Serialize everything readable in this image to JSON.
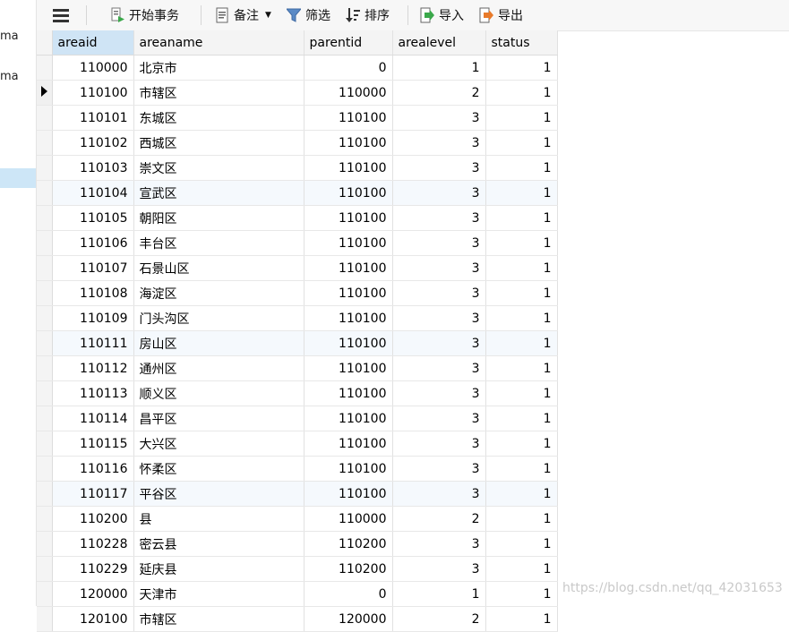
{
  "sidebar": {
    "items": [
      "ma",
      "ma"
    ]
  },
  "toolbar": {
    "menu_icon": "hamburger-menu-icon",
    "begin_transaction": "开始事务",
    "note": "备注",
    "filter": "筛选",
    "sort": "排序",
    "import": "导入",
    "export": "导出"
  },
  "grid": {
    "columns": [
      "areaid",
      "areaname",
      "parentid",
      "arealevel",
      "status"
    ],
    "rows": [
      [
        "110000",
        "北京市",
        "0",
        "1",
        "1"
      ],
      [
        "110100",
        "市辖区",
        "110000",
        "2",
        "1"
      ],
      [
        "110101",
        "东城区",
        "110100",
        "3",
        "1"
      ],
      [
        "110102",
        "西城区",
        "110100",
        "3",
        "1"
      ],
      [
        "110103",
        "崇文区",
        "110100",
        "3",
        "1"
      ],
      [
        "110104",
        "宣武区",
        "110100",
        "3",
        "1"
      ],
      [
        "110105",
        "朝阳区",
        "110100",
        "3",
        "1"
      ],
      [
        "110106",
        "丰台区",
        "110100",
        "3",
        "1"
      ],
      [
        "110107",
        "石景山区",
        "110100",
        "3",
        "1"
      ],
      [
        "110108",
        "海淀区",
        "110100",
        "3",
        "1"
      ],
      [
        "110109",
        "门头沟区",
        "110100",
        "3",
        "1"
      ],
      [
        "110111",
        "房山区",
        "110100",
        "3",
        "1"
      ],
      [
        "110112",
        "通州区",
        "110100",
        "3",
        "1"
      ],
      [
        "110113",
        "顺义区",
        "110100",
        "3",
        "1"
      ],
      [
        "110114",
        "昌平区",
        "110100",
        "3",
        "1"
      ],
      [
        "110115",
        "大兴区",
        "110100",
        "3",
        "1"
      ],
      [
        "110116",
        "怀柔区",
        "110100",
        "3",
        "1"
      ],
      [
        "110117",
        "平谷区",
        "110100",
        "3",
        "1"
      ],
      [
        "110200",
        "县",
        "110000",
        "2",
        "1"
      ],
      [
        "110228",
        "密云县",
        "110200",
        "3",
        "1"
      ],
      [
        "110229",
        "延庆县",
        "110200",
        "3",
        "1"
      ],
      [
        "120000",
        "天津市",
        "0",
        "1",
        "1"
      ],
      [
        "120100",
        "市辖区",
        "120000",
        "2",
        "1"
      ]
    ],
    "selected_row_index": 1
  },
  "watermark": "https://blog.csdn.net/qq_42031653"
}
